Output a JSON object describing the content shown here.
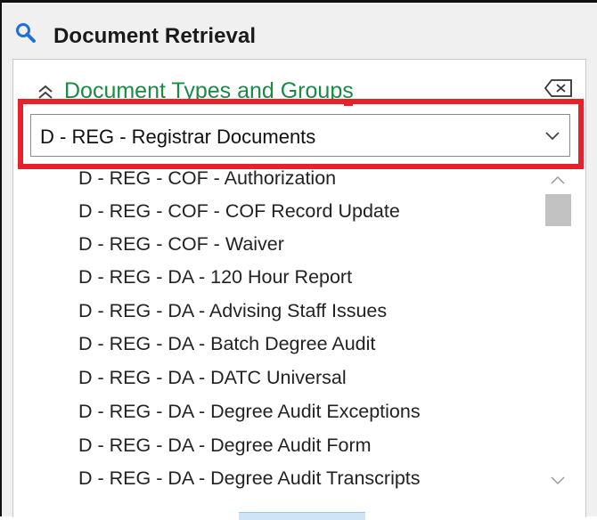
{
  "window": {
    "title": "Document Retrieval",
    "icon": "search-icon"
  },
  "section": {
    "title": "Document Types and Groups",
    "collapse_icon": "double-chevron-up-icon",
    "clear_icon": "clear-backspace-icon"
  },
  "select": {
    "value": "D - REG - Registrar Documents",
    "chevron": "chevron-down-icon"
  },
  "document_types": [
    "D - REG - COF - Authorization",
    "D - REG - COF - COF Record Update",
    "D - REG - COF - Waiver",
    "D - REG - DA - 120 Hour Report",
    "D - REG - DA - Advising Staff Issues",
    "D - REG - DA - Batch Degree Audit",
    "D - REG - DA - DATC Universal",
    "D - REG - DA - Degree Audit Exceptions",
    "D - REG - DA - Degree Audit Form",
    "D - REG - DA - Degree Audit Transcripts"
  ],
  "colors": {
    "accent_green": "#1a8a46",
    "highlight_red": "#e8202a",
    "search_blue": "#1e6fd9"
  }
}
